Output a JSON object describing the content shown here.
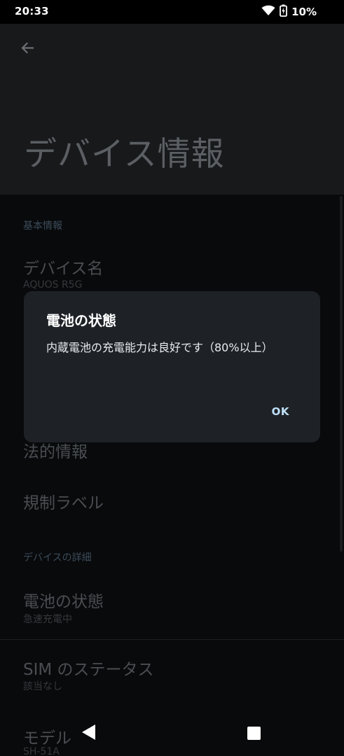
{
  "status_bar": {
    "time": "20:33",
    "battery_percent": "10%"
  },
  "header": {
    "title": "デバイス情報"
  },
  "sections": {
    "basic_info": "基本情報",
    "device_details": "デバイスの詳細"
  },
  "items": {
    "device_name": {
      "title": "デバイス名",
      "summary": "AQUOS R5G"
    },
    "legal_info": {
      "title": "法的情報"
    },
    "regulatory_labels": {
      "title": "規制ラベル"
    },
    "battery_status": {
      "title": "電池の状態",
      "summary": "急速充電中"
    },
    "sim_status": {
      "title": "SIM のステータス",
      "summary": "該当なし"
    },
    "model": {
      "title": "モデル",
      "summary": "SH-51A"
    }
  },
  "dialog": {
    "title": "電池の状態",
    "message": "内蔵電池の充電能力は良好です（80%以上）",
    "ok_label": "OK"
  },
  "icons": {
    "wifi": "wifi-icon",
    "battery": "battery-charging-icon",
    "back": "back-arrow-icon",
    "nav_back": "nav-back-icon",
    "nav_recents": "nav-recents-icon"
  },
  "colors": {
    "dialog_background": "#1e2226",
    "accent": "#bfe0f8",
    "header_background": "#17191b"
  }
}
